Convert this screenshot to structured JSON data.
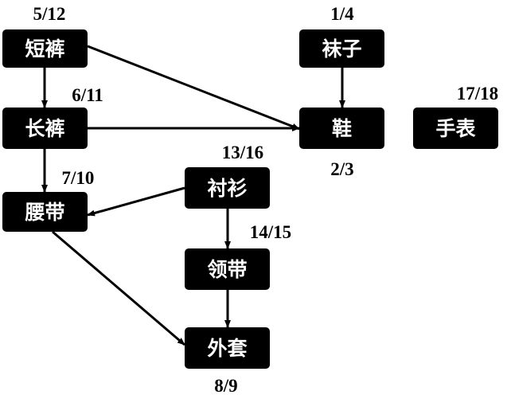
{
  "colors": {
    "node_fill": "#000000",
    "node_text": "#ffffff",
    "edge": "#000000",
    "label_text": "#000000"
  },
  "nodes": [
    {
      "id": "shorts",
      "label": "短裤",
      "time": "5/12"
    },
    {
      "id": "socks",
      "label": "袜子",
      "time": "1/4"
    },
    {
      "id": "pants",
      "label": "长裤",
      "time": "6/11"
    },
    {
      "id": "shoes",
      "label": "鞋",
      "time": "2/3"
    },
    {
      "id": "watch",
      "label": "手表",
      "time": "17/18"
    },
    {
      "id": "belt",
      "label": "腰带",
      "time": "7/10"
    },
    {
      "id": "shirt",
      "label": "衬衫",
      "time": "13/16"
    },
    {
      "id": "tie",
      "label": "领带",
      "time": "14/15"
    },
    {
      "id": "jacket",
      "label": "外套",
      "time": "8/9"
    }
  ],
  "edges": [
    {
      "from": "shorts",
      "to": "pants"
    },
    {
      "from": "shorts",
      "to": "shoes"
    },
    {
      "from": "socks",
      "to": "shoes"
    },
    {
      "from": "pants",
      "to": "shoes"
    },
    {
      "from": "pants",
      "to": "belt"
    },
    {
      "from": "shirt",
      "to": "belt"
    },
    {
      "from": "shirt",
      "to": "tie"
    },
    {
      "from": "tie",
      "to": "jacket"
    },
    {
      "from": "belt",
      "to": "jacket"
    }
  ]
}
